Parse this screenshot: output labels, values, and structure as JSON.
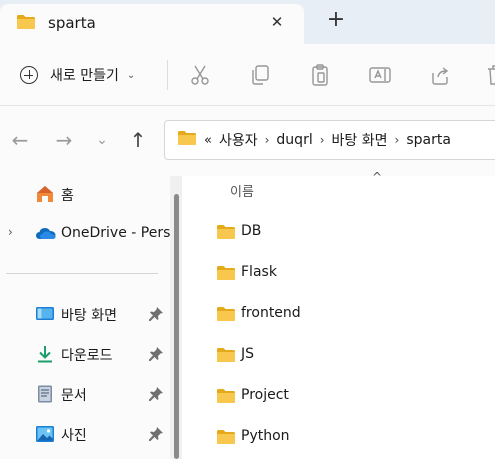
{
  "window": {
    "tab_title": "sparta",
    "close_symbol": "✕",
    "newtab_symbol": "+"
  },
  "toolbar": {
    "new_label": "새로 만들기",
    "new_chevron": "⌄",
    "icons": [
      "cut-icon",
      "copy-icon",
      "paste-icon",
      "rename-icon",
      "share-icon",
      "delete-icon"
    ]
  },
  "nav": {
    "back": "←",
    "forward": "→",
    "recent": "⌄",
    "up": "↑"
  },
  "address": {
    "overflow": "«",
    "crumbs": [
      "사용자",
      "duqrl",
      "바탕 화면",
      "sparta"
    ],
    "separator": "›"
  },
  "sidebar": {
    "items": [
      {
        "label": "홈",
        "icon": "home-icon"
      },
      {
        "label": "OneDrive - Pers",
        "icon": "onedrive-cloud-icon",
        "expand": "›"
      }
    ],
    "pinned": [
      {
        "label": "바탕 화면",
        "icon": "desktop-icon"
      },
      {
        "label": "다운로드",
        "icon": "download-icon"
      },
      {
        "label": "문서",
        "icon": "documents-icon"
      },
      {
        "label": "사진",
        "icon": "pictures-icon"
      }
    ]
  },
  "content": {
    "column_header": "이름",
    "sort_caret": "^",
    "folders": [
      "DB",
      "Flask",
      "frontend",
      "JS",
      "Project",
      "Python"
    ]
  },
  "colors": {
    "folder": "#f8c84e",
    "folder_dark": "#e5a91c",
    "accent": "#0067c0",
    "tabstrip": "#e8eef6"
  }
}
